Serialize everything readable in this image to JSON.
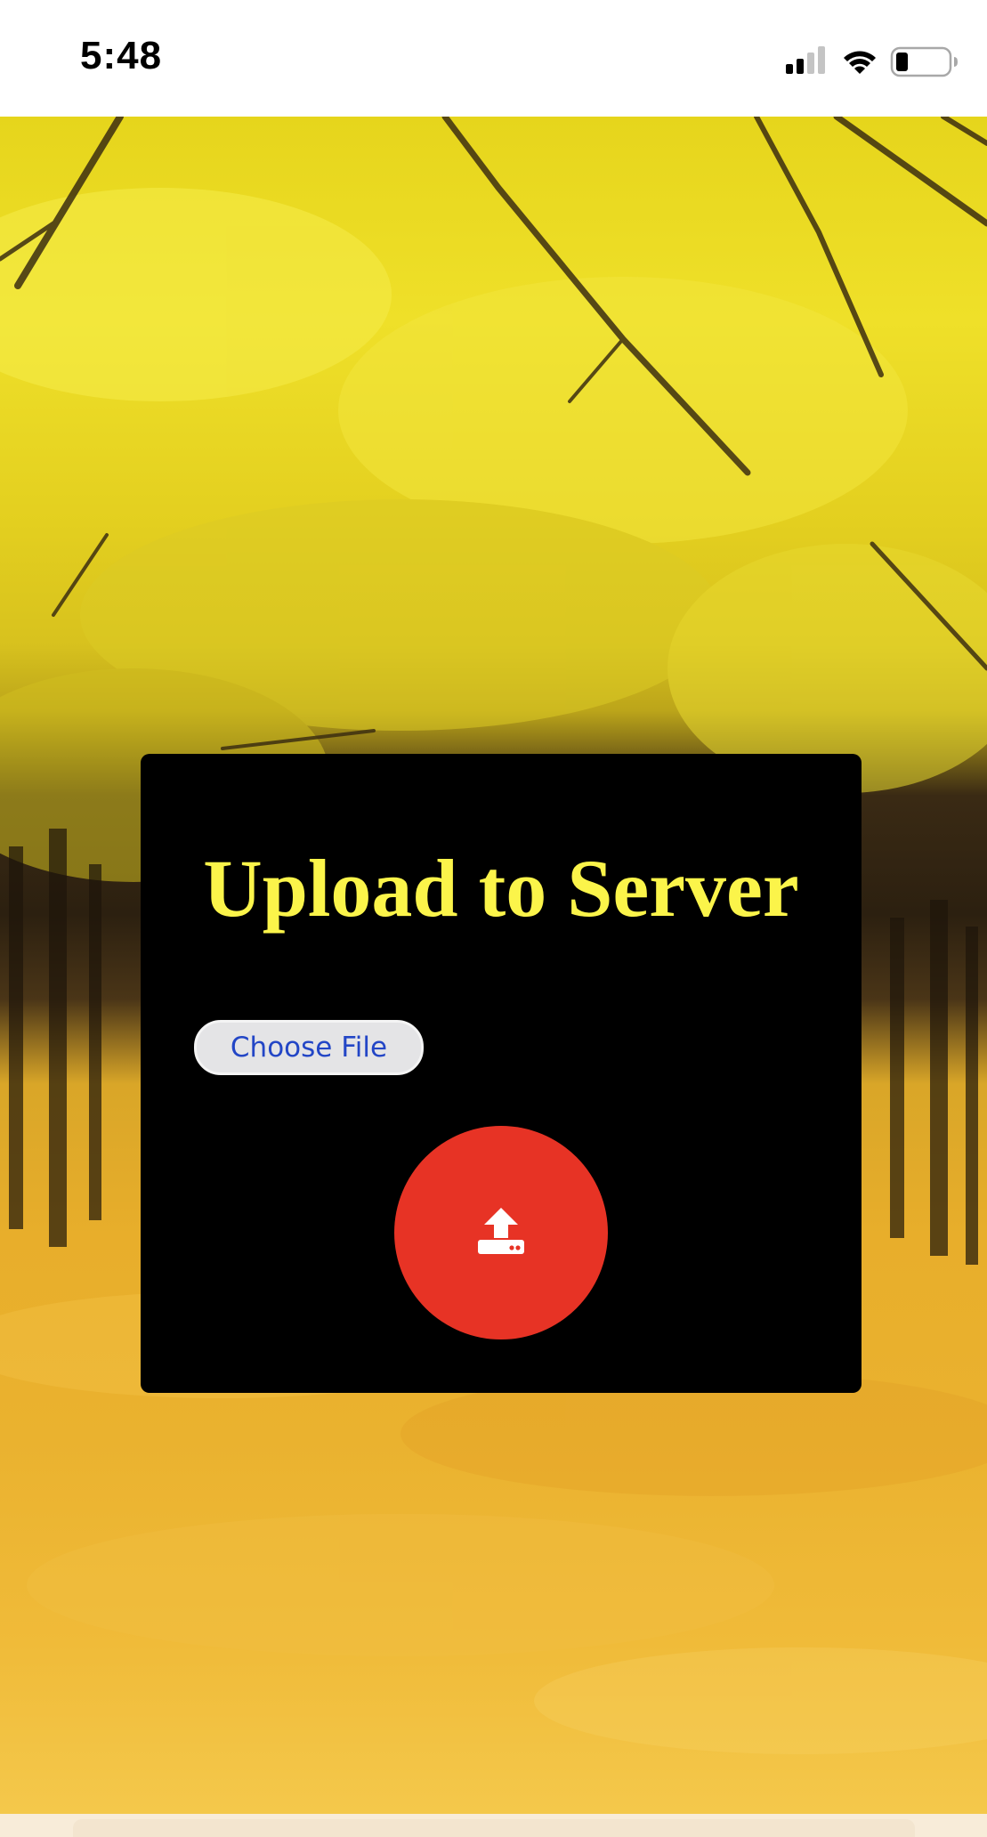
{
  "status_bar": {
    "time": "5:48",
    "icons": [
      "cellular-signal-icon",
      "wifi-icon",
      "battery-icon"
    ]
  },
  "background": {
    "icon": "autumn-forest-photo"
  },
  "upload_card": {
    "title": "Upload to Server",
    "file_input": {
      "label": "Choose File"
    },
    "upload_button": {
      "icon": "upload-icon"
    }
  },
  "colors": {
    "card_background": "#000000",
    "title_color": "#fbf44a",
    "upload_button": "#e73325",
    "file_button_text": "#2346c6",
    "file_button_background": "#e4e4e6"
  }
}
